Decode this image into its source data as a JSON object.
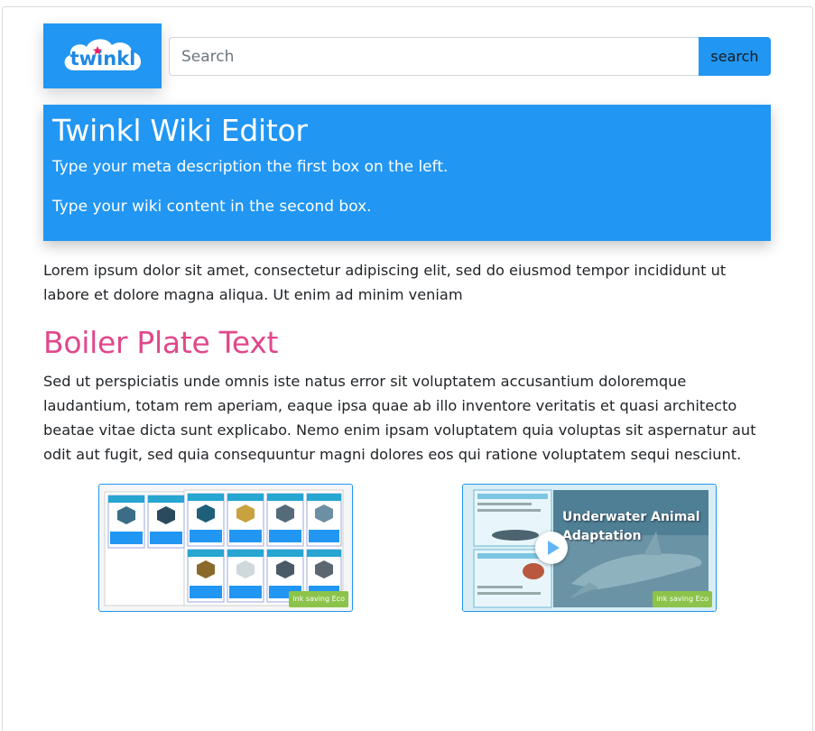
{
  "header": {
    "logo_text": "twinkl",
    "search": {
      "placeholder": "Search",
      "value": ""
    },
    "search_button_label": "search"
  },
  "hero": {
    "title": "Twinkl Wiki Editor",
    "line1": "Type your meta description the first box on the left.",
    "line2": "Type your wiki content in the second box."
  },
  "content": {
    "intro": "Lorem ipsum dolor sit amet, consectetur adipiscing elit, sed do eiusmod tempor incididunt ut labore et dolore magna aliqua. Ut enim ad minim veniam",
    "section_title": "Boiler Plate Text",
    "section_body": "Sed ut perspiciatis unde omnis iste natus error sit voluptatem accusantium doloremque laudantium, totam rem aperiam, eaque ipsa quae ab illo inventore veritatis et quasi architecto beatae vitae dicta sunt explicabo. Nemo enim ipsam voluptatem quia voluptas sit aspernatur aut odit aut fugit, sed quia consequuntur magni dolores eos qui ratione voluptatem sequi nesciunt."
  },
  "thumbnails": [
    {
      "badge": "ink saving",
      "badge_tag": "Eco"
    },
    {
      "title": "Underwater Animal Adaptation",
      "badge": "ink saving",
      "badge_tag": "Eco"
    }
  ],
  "colors": {
    "brand_blue": "#2196f3",
    "heading_pink": "#e0488b"
  }
}
